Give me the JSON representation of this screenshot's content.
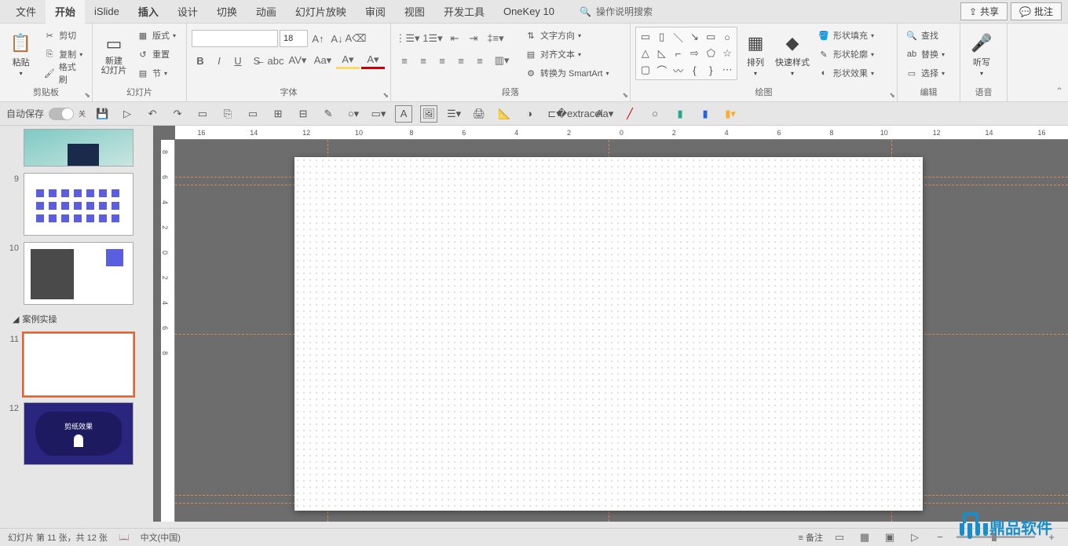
{
  "menubar": {
    "items": [
      "文件",
      "开始",
      "iSlide",
      "插入",
      "设计",
      "切换",
      "动画",
      "幻灯片放映",
      "审阅",
      "视图",
      "开发工具",
      "OneKey 10"
    ],
    "active_index": 1,
    "search_placeholder": "操作说明搜索",
    "share": "共享",
    "comment": "批注"
  },
  "ribbon": {
    "clipboard": {
      "paste": "粘贴",
      "cut": "剪切",
      "copy": "复制",
      "format_painter": "格式刷",
      "label": "剪贴板"
    },
    "slides": {
      "new_slide": "新建\n幻灯片",
      "layout": "版式",
      "reset": "重置",
      "section": "节",
      "label": "幻灯片"
    },
    "font": {
      "size": "18",
      "label": "字体"
    },
    "paragraph": {
      "text_direction": "文字方向",
      "align_text": "对齐文本",
      "convert_smartart": "转换为 SmartArt",
      "label": "段落"
    },
    "drawing": {
      "arrange": "排列",
      "quick_styles": "快速样式",
      "shape_fill": "形状填充",
      "shape_outline": "形状轮廓",
      "shape_effects": "形状效果",
      "label": "绘图"
    },
    "editing": {
      "find": "查找",
      "replace": "替换",
      "select": "选择",
      "label": "编辑"
    },
    "voice": {
      "dictate": "听写",
      "label": "语音"
    }
  },
  "qat": {
    "autosave": "自动保存",
    "autosave_state": "关"
  },
  "thumbs": {
    "visible": [
      {
        "num": "",
        "cls": "thumb-8"
      },
      {
        "num": "9",
        "cls": "thumb-9"
      },
      {
        "num": "10",
        "cls": "thumb-10"
      },
      {
        "num": "11",
        "cls": "",
        "selected": true
      },
      {
        "num": "12",
        "cls": "thumb-12"
      }
    ],
    "section": "案例实操",
    "slide12_text": "剪纸效果"
  },
  "ruler": {
    "h": [
      "16",
      "14",
      "12",
      "10",
      "8",
      "6",
      "4",
      "2",
      "0",
      "2",
      "4",
      "6",
      "8",
      "10",
      "12",
      "14",
      "16"
    ],
    "v": [
      "8",
      "6",
      "4",
      "2",
      "0",
      "2",
      "4",
      "6",
      "8"
    ]
  },
  "statusbar": {
    "slide_info": "幻灯片 第 11 张，共 12 张",
    "language": "中文(中国)",
    "notes": "备注"
  },
  "watermark": "鼎品软件"
}
